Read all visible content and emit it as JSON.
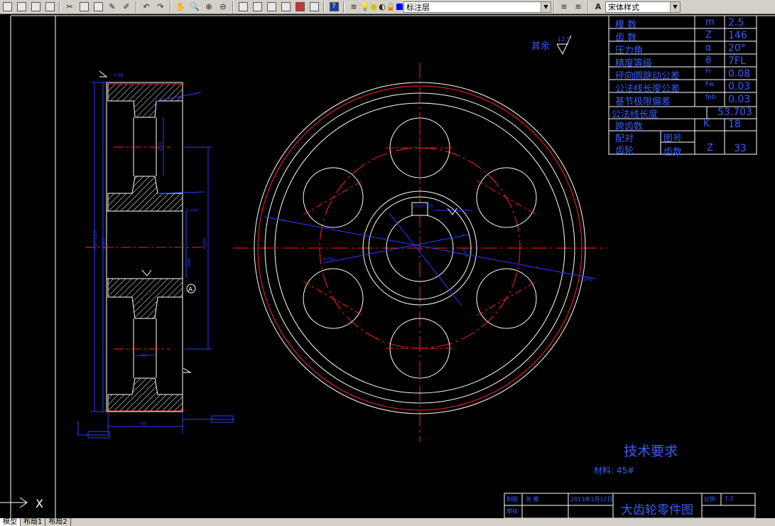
{
  "toolbar": {
    "layer_name": "标注层",
    "text_style": "宋体样式"
  },
  "spec_table": {
    "rows": [
      {
        "label": "模    数",
        "symbol": "m",
        "value": "2.5"
      },
      {
        "label": "齿    数",
        "symbol": "Z",
        "value": "146"
      },
      {
        "label": "压力角",
        "symbol": "α",
        "value": "20°"
      },
      {
        "label": "精度等级",
        "symbol": "ϑ",
        "value": "7FL"
      },
      {
        "label": "径向圆跳动公差",
        "symbol": "Fr",
        "value": "0.08"
      },
      {
        "label": "公法线长度公差",
        "symbol": "Fw",
        "value": "0.03"
      },
      {
        "label": "基节极限偏差",
        "symbol": "fpb",
        "value": "0.03"
      },
      {
        "label": "公法线长度",
        "symbol": "",
        "value": "53.703"
      },
      {
        "label": "跨齿数",
        "symbol": "K",
        "value": "18"
      }
    ],
    "pair_label_1": "配对",
    "pair_label_2": "齿轮",
    "pair_col_1": "图号",
    "pair_col_2": "齿数",
    "pair_symbol": "Z",
    "pair_value": "33"
  },
  "notes": {
    "surface_finish": "其余",
    "surface_value": "12.5",
    "tech_title": "技术要求",
    "material": "材料: 45#"
  },
  "title_block": {
    "drawing_title": "大齿轮零件图",
    "designer_label": "制图",
    "designer": "张 雅",
    "checker_label": "审核",
    "date": "2013年1月12日",
    "scale_label": "比例",
    "scale": "1:2"
  },
  "ucs": {
    "x_label": "X"
  },
  "tabs": [
    {
      "label": "模型",
      "active": true
    },
    {
      "label": "布局1",
      "active": false
    },
    {
      "label": "布局2",
      "active": false
    }
  ]
}
